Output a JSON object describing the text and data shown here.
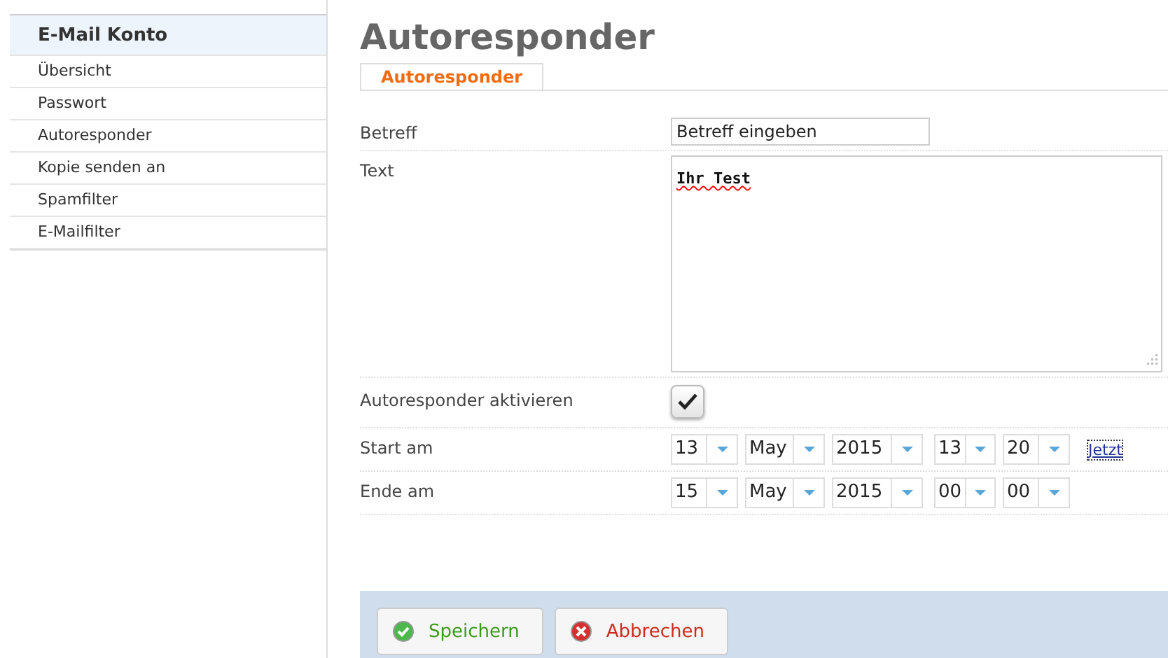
{
  "sidebar": {
    "title": "E-Mail Konto",
    "items": [
      {
        "label": "Übersicht"
      },
      {
        "label": "Passwort"
      },
      {
        "label": "Autoresponder"
      },
      {
        "label": "Kopie senden an"
      },
      {
        "label": "Spamfilter"
      },
      {
        "label": "E-Mailfilter"
      }
    ]
  },
  "page_title": "Autoresponder",
  "tabs": [
    {
      "label": "Autoresponder",
      "selected": true
    }
  ],
  "form": [
    {
      "kind": "text",
      "label": "Betreff",
      "value": "Betreff eingeben"
    },
    {
      "kind": "textarea",
      "label": "Text",
      "value": "Ihr Test"
    },
    {
      "kind": "checkbox",
      "label": "Autoresponder aktivieren",
      "checked": true
    },
    {
      "kind": "datetime",
      "label": "Start am",
      "selects": [
        "13",
        "May",
        "2015",
        "13",
        "20"
      ],
      "link": "Jetzt"
    },
    {
      "kind": "datetime",
      "label": "Ende am",
      "selects": [
        "15",
        "May",
        "2015",
        "00",
        "00"
      ]
    }
  ],
  "buttons": [
    {
      "kind": "save",
      "label": "Speichern"
    },
    {
      "kind": "cancel",
      "label": "Abbrechen"
    }
  ]
}
